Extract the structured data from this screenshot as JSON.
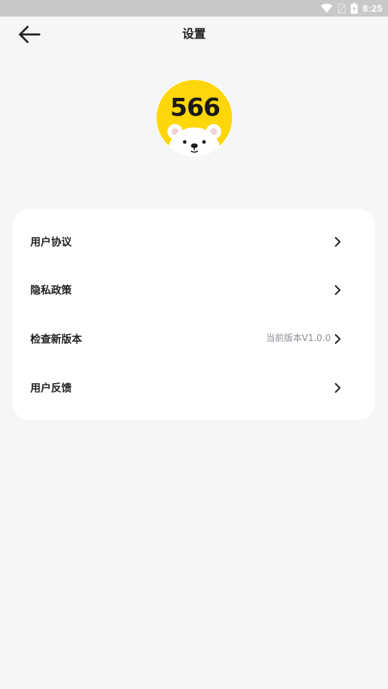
{
  "status_bar": {
    "time": "8:25",
    "icons": [
      "wifi-icon",
      "no-sim-icon",
      "battery-charging-icon"
    ]
  },
  "header": {
    "title": "设置",
    "back_icon": "arrow-left-icon"
  },
  "logo": {
    "text": "566",
    "description_icon": "bear-logo-icon",
    "color": "#ffd60a"
  },
  "settings": {
    "items": [
      {
        "label": "用户协议",
        "value": "",
        "icon": "chevron-right-icon"
      },
      {
        "label": "隐私政策",
        "value": "",
        "icon": "chevron-right-icon"
      },
      {
        "label": "检查新版本",
        "value": "当前版本V1.0.0",
        "icon": "chevron-right-icon"
      },
      {
        "label": "用户反馈",
        "value": "",
        "icon": "chevron-right-icon"
      }
    ]
  },
  "colors": {
    "background": "#f5f6f8",
    "card": "#ffffff",
    "status_bar": "#c8c8ca",
    "text_primary": "#222222",
    "text_secondary": "#888c94"
  }
}
